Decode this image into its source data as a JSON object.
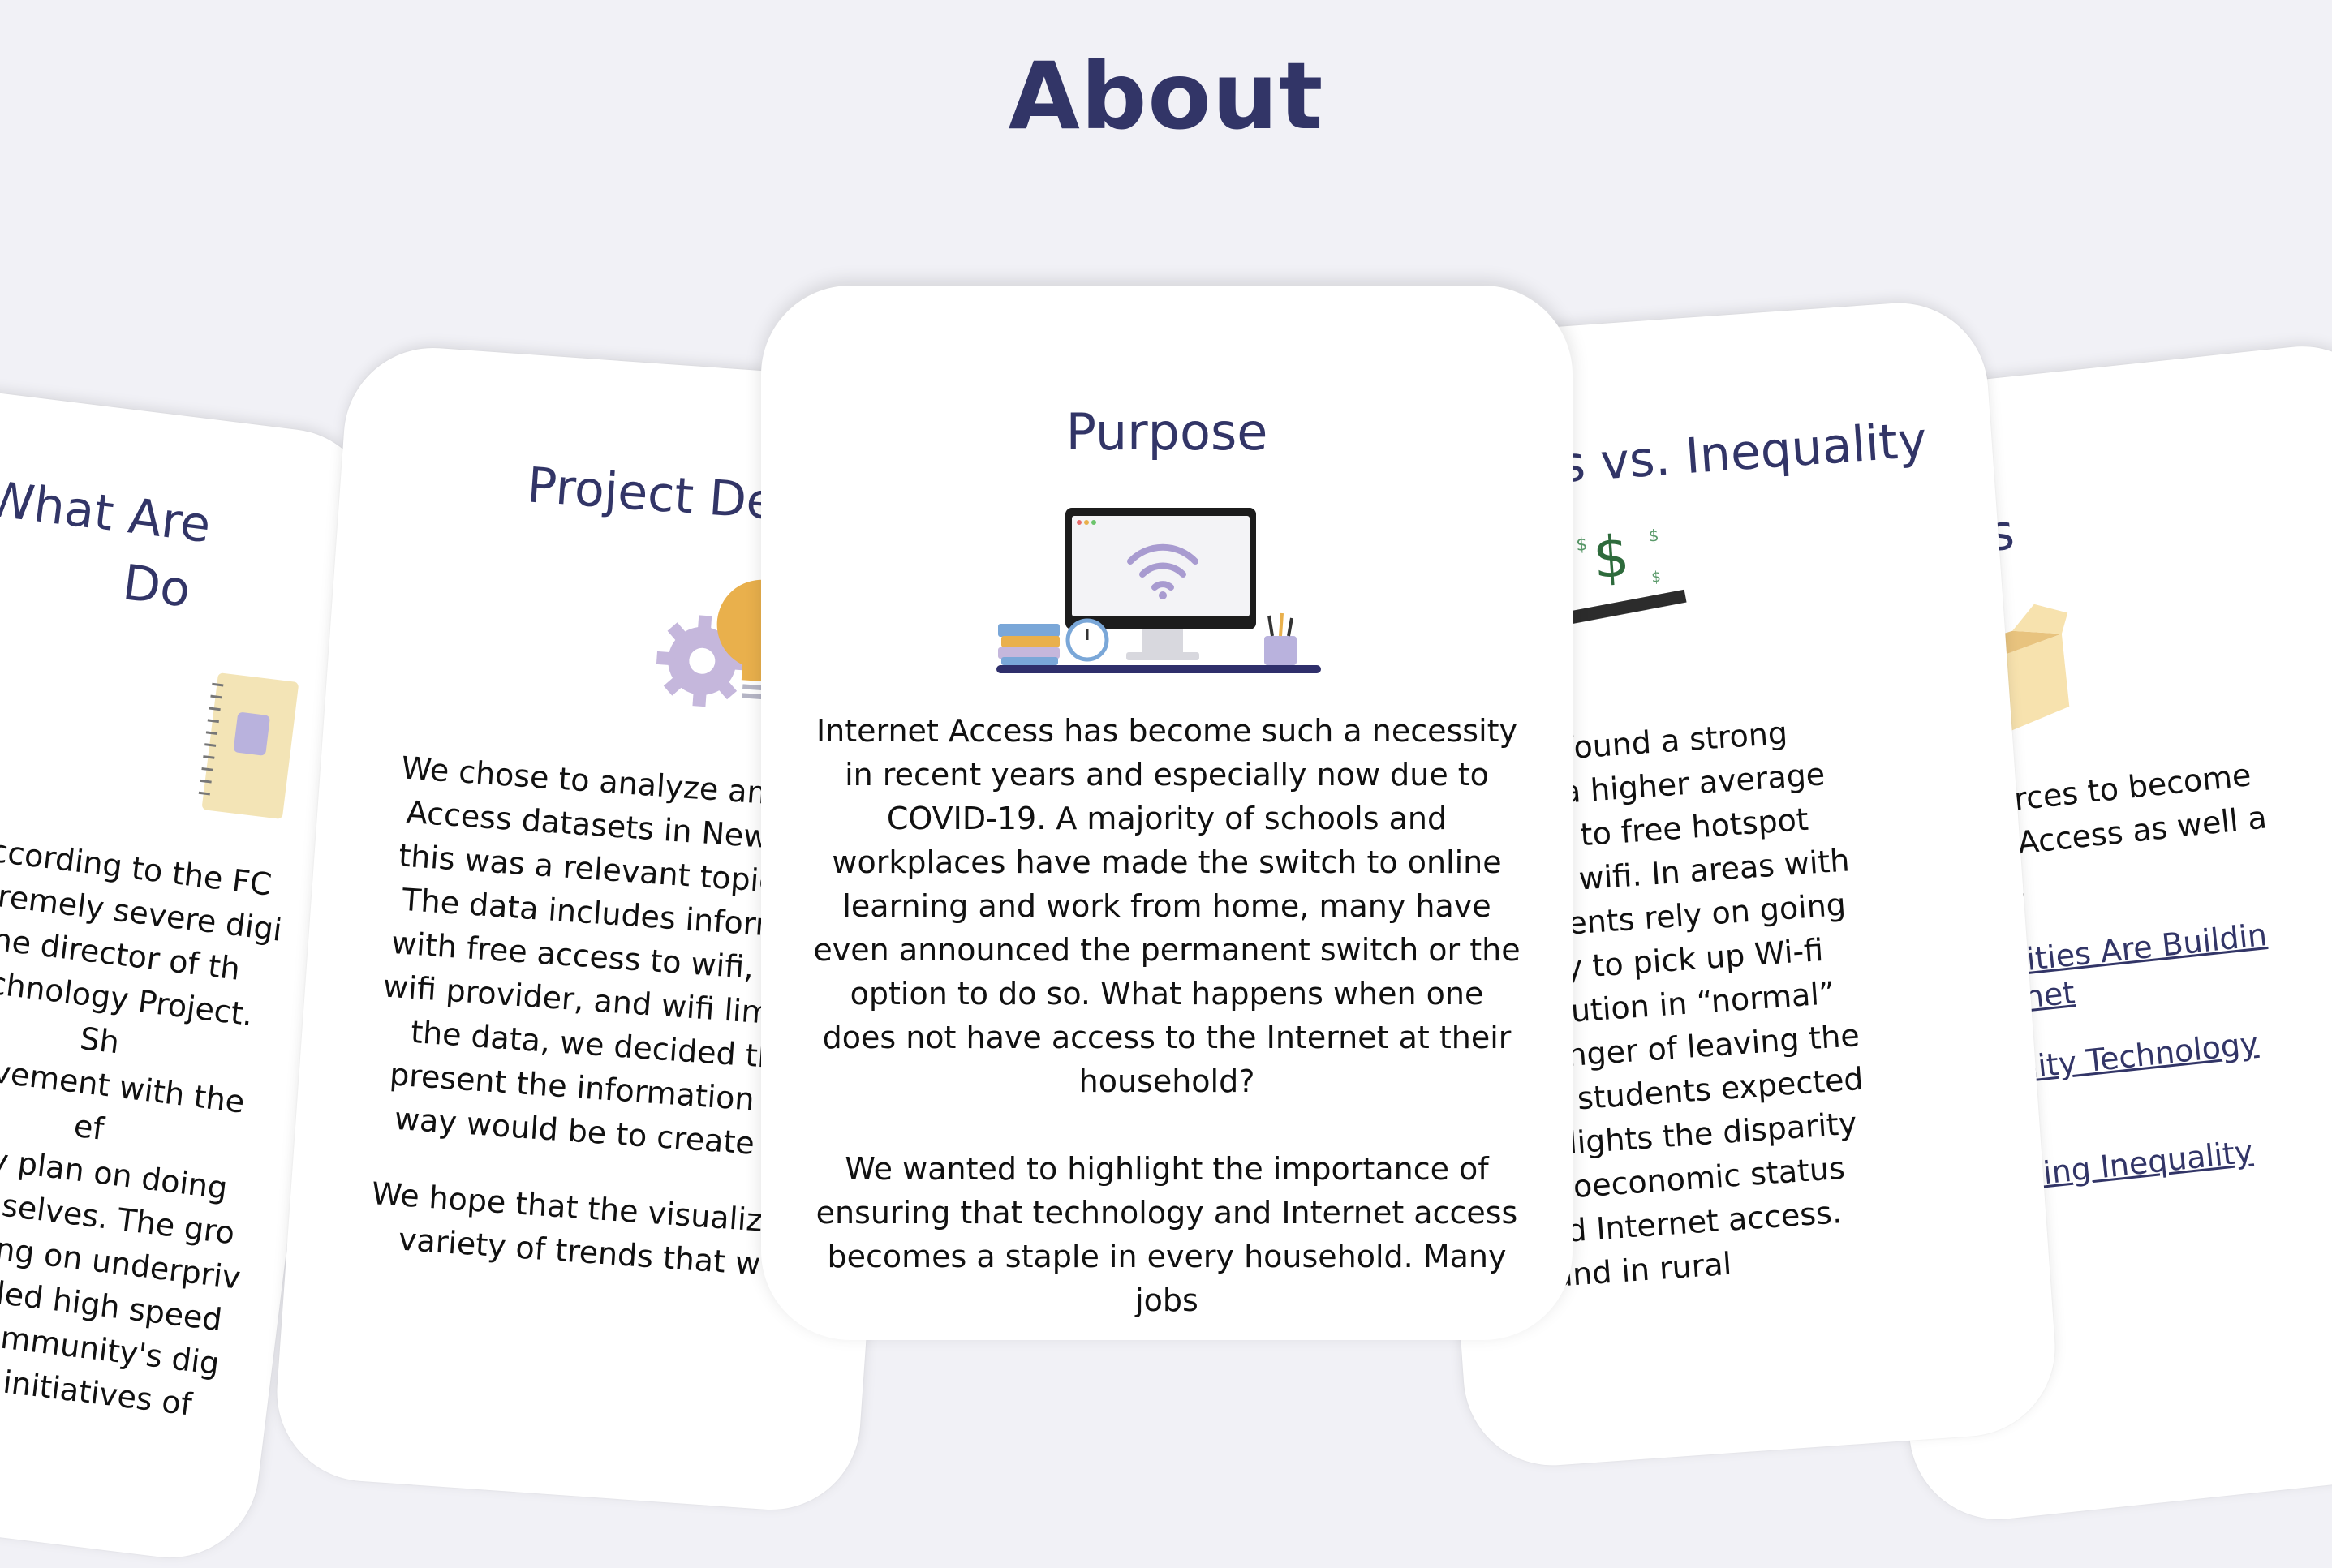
{
  "page": {
    "title": "About"
  },
  "cards": {
    "digital_divide": {
      "title": "What Are Digital Divide",
      "title_line1": "What Are",
      "title_line2": "Do",
      "paragraphs": [
        "According to the FCC extremely severe digital the director of the Technology Project. She movement with the effort they plan on doing themselves. The group focusing on underprivileged installed high speed the community's digital their initiatives of"
      ],
      "lines": [
        "According to the FC",
        "extremely severe digi",
        "the director of th",
        "Technology Project. Sh",
        "movement with the ef",
        "they plan on doing",
        "themselves. The gro",
        "focusing on underpriv",
        "installed high speed",
        "the community's dig",
        "their initiatives of"
      ]
    },
    "project_description": {
      "title": "Project Des",
      "lines": [
        "We chose to analyze and lo",
        "Access datasets in New Yo",
        "this was a relevant topic in",
        "The data includes informa",
        "with free access to wifi, inc",
        "wifi provider, and wifi limita",
        "the data, we decided th",
        "present the information in",
        "way would be to create c"
      ],
      "lines2": [
        "We hope that the visualizat",
        "variety of trends that w"
      ]
    },
    "purpose": {
      "title": "Purpose",
      "paragraph1": "Internet Access has become such a necessity in recent years and especially now due to COVID-19. A majority of schools and workplaces have made the switch to online learning and work from home, many have even announced the permanent switch or the option to do so. What happens when one does not have access to the Internet at their household?",
      "paragraph2": "We wanted to highlight the importance of ensuring that technology and Internet access becomes a staple in every household. Many jobs"
    },
    "access_inequality": {
      "title": "ess vs. Inequality",
      "lines": [
        "data, we found a strong",
        "eas with a higher average",
        "re access to free hotspot",
        "ousehold wifi. In areas with",
        "me, students rely on going",
        "he library to pick up Wi-fi",
        "e the solution in “normal”",
        "dded danger of leaving the",
        "how are students expected",
        "his highlights the disparity",
        "low socioeconomic status",
        "logy and Internet access.",
        "home and in rural"
      ]
    },
    "resources": {
      "title": "rces",
      "lines": [
        "esources to become",
        "rent Access as well a",
        "help."
      ],
      "links": [
        {
          "line1": "munities Are Buildin",
          "line2": "nternet"
        },
        {
          "line1": "munity Technology",
          "line2": "ct"
        },
        {
          "line1": "Driving Inequality",
          "line2": ""
        }
      ]
    }
  },
  "colors": {
    "heading": "#323567",
    "background": "#f1f1f6",
    "card": "#ffffff",
    "wifi": "#a89bd0",
    "gear": "#c5b7dc",
    "bulb": "#e9b04c",
    "money": "#2e6b3c",
    "box": "#f3d89b"
  },
  "icons": [
    "notebook-icon",
    "gears-lightbulb-icon",
    "desktop-wifi-icon",
    "seesaw-money-icon",
    "open-box-icon"
  ]
}
